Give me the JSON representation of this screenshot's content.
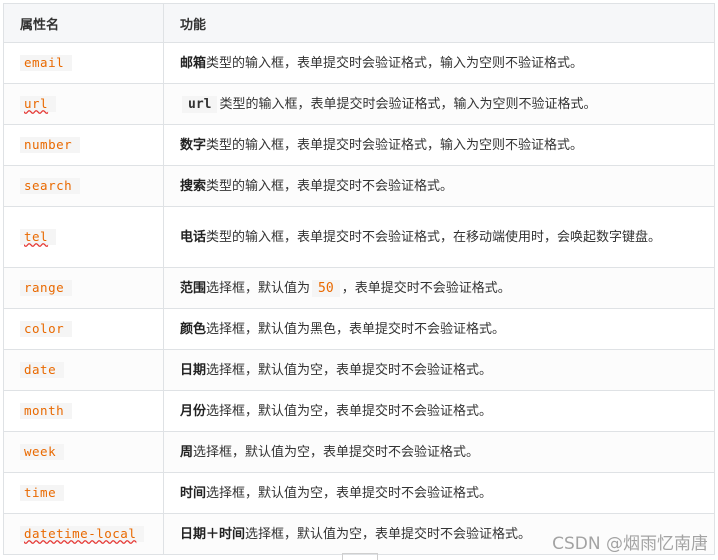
{
  "header": {
    "col1": "属性名",
    "col2": "功能"
  },
  "rows": [
    {
      "name": "email",
      "bold": "邮箱",
      "rest": "类型的输入框，表单提交时会验证格式，输入为空则不验证格式。"
    },
    {
      "name": "url",
      "code": "url",
      "rest": "类型的输入框，表单提交时会验证格式，输入为空则不验证格式。"
    },
    {
      "name": "number",
      "bold": "数字",
      "rest": "类型的输入框，表单提交时会验证格式，输入为空则不验证格式。"
    },
    {
      "name": "search",
      "bold": "搜索",
      "rest": "类型的输入框，表单提交时不会验证格式。"
    },
    {
      "name": "tel",
      "bold": "电话",
      "rest": "类型的输入框，表单提交时不会验证格式，在移动端使用时，会唤起数字键盘。"
    },
    {
      "name": "range",
      "bold": "范围",
      "rest_a": "选择框，默认值为",
      "num": "50",
      "rest_b": "，表单提交时不会验证格式。"
    },
    {
      "name": "color",
      "bold": "颜色",
      "rest": "选择框，默认值为黑色，表单提交时不会验证格式。"
    },
    {
      "name": "date",
      "bold": "日期",
      "rest": "选择框，默认值为空，表单提交时不会验证格式。"
    },
    {
      "name": "month",
      "bold": "月份",
      "rest": "选择框，默认值为空，表单提交时不会验证格式。"
    },
    {
      "name": "week",
      "bold": "周",
      "rest": "选择框，默认值为空，表单提交时不会验证格式。"
    },
    {
      "name": "time",
      "bold": "时间",
      "rest": "选择框，默认值为空，表单提交时不会验证格式。"
    },
    {
      "name": "datetime-local",
      "bold": "日期＋时间",
      "rest": "选择框，默认值为空，表单提交时不会验证格式。"
    }
  ],
  "watermark": "CSDN @烟雨忆南唐"
}
